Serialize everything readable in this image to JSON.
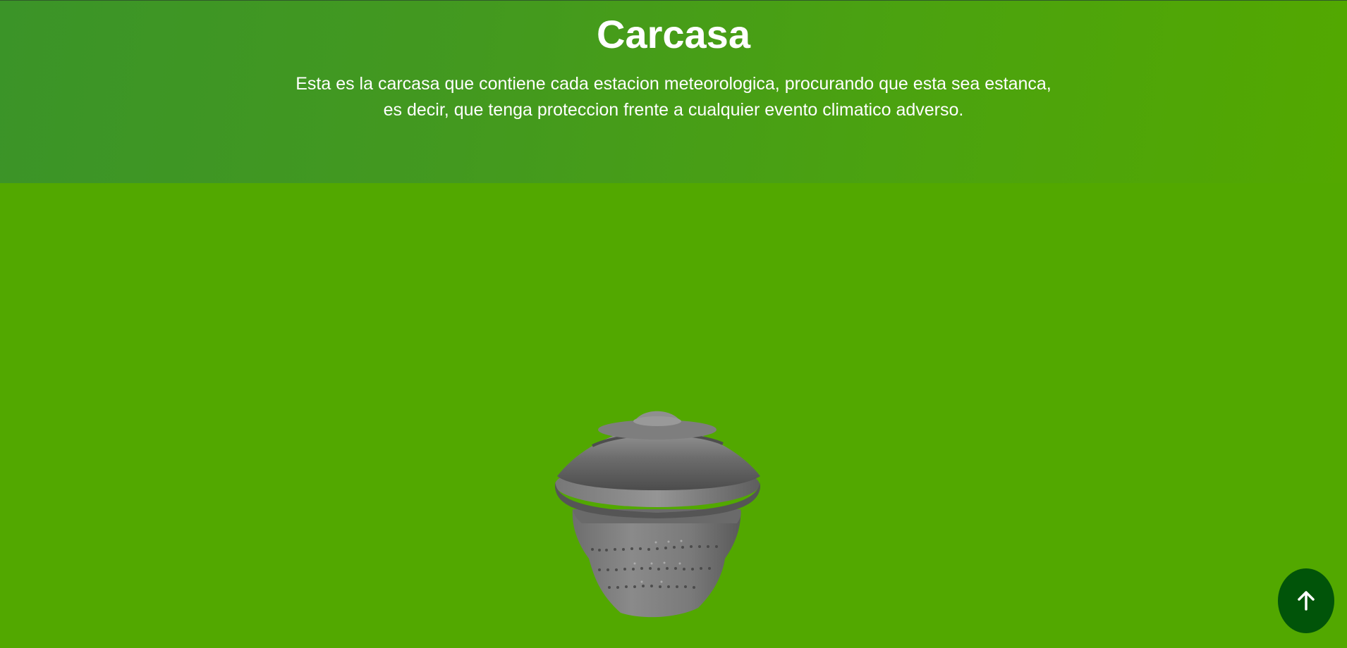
{
  "header": {
    "title": "Carcasa",
    "description_line1": "Esta es la carcasa que contiene cada estacion meteorologica, procurando que esta sea estanca,",
    "description_line2": "es decir, que tenga proteccion frente a cualquier evento climatico adverso."
  },
  "viewer": {
    "model_icon": "weather-station-housing-3d-model"
  },
  "scroll_top": {
    "icon": "arrow-up-icon",
    "color": "#015409"
  },
  "colors": {
    "page_background": "#52a800",
    "header_gradient_start": "#3b9428",
    "header_gradient_end": "#53a800",
    "text": "#ffffff"
  }
}
